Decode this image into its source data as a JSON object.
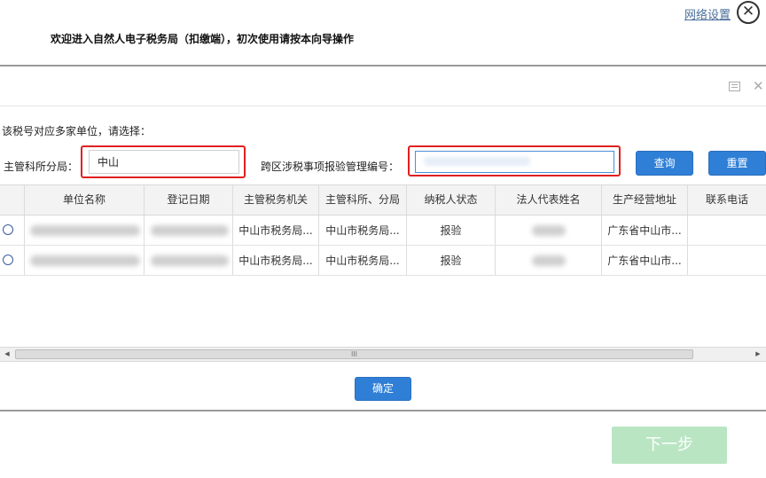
{
  "header": {
    "welcome": "欢迎进入自然人电子税务局（扣缴端），初次使用请按本向导操作",
    "network_settings": "网络设置",
    "close_symbol": "✕"
  },
  "dialog": {
    "close_symbol": "✕",
    "prompt": "该税号对应多家单位，请选择：",
    "office_label": "主管科所分局：",
    "office_value": "中山",
    "cross_label": "跨区涉税事项报验管理编号：",
    "cross_value": "",
    "query_button": "查询",
    "reset_button": "重置",
    "ok_button": "确定"
  },
  "table": {
    "columns": [
      "单位名称",
      "登记日期",
      "主管税务机关",
      "主管科所、分局",
      "纳税人状态",
      "法人代表姓名",
      "生产经营地址",
      "联系电话"
    ],
    "rows": [
      {
        "company": "",
        "reg_date": "",
        "tax_office": "中山市税务局...",
        "branch": "中山市税务局...",
        "status": "报验",
        "legal_rep": "",
        "address": "广东省中山市...",
        "phone": ""
      },
      {
        "company": "",
        "reg_date": "",
        "tax_office": "中山市税务局...",
        "branch": "中山市税务局...",
        "status": "报验",
        "legal_rep": "",
        "address": "广东省中山市...",
        "phone": ""
      }
    ],
    "scroll_grip": "III",
    "scroll_left": "◀",
    "scroll_right": "▶"
  },
  "footer": {
    "next_button": "下一步"
  },
  "colors": {
    "accent_blue": "#2f7fd6",
    "highlight_red": "#e02020",
    "next_disabled_green": "#b9e5c3"
  }
}
